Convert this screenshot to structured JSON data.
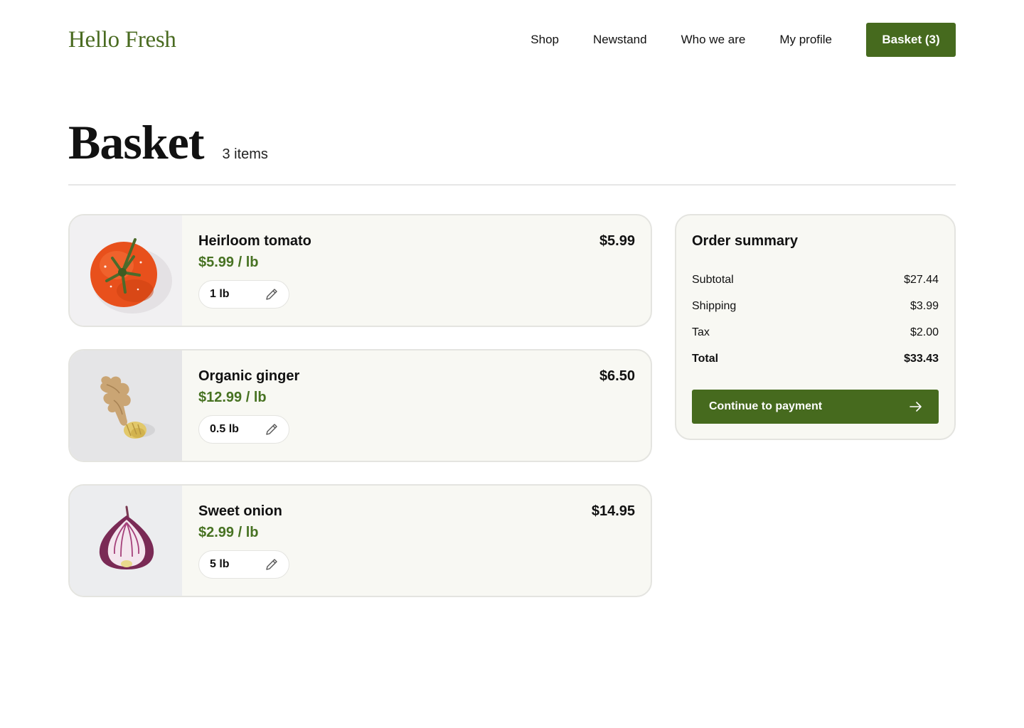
{
  "header": {
    "logo": "Hello Fresh",
    "nav": [
      "Shop",
      "Newstand",
      "Who we are",
      "My profile"
    ],
    "basket_button": "Basket (3)"
  },
  "page": {
    "title": "Basket",
    "item_count": "3 items"
  },
  "items": [
    {
      "name": "Heirloom tomato",
      "unit_price": "$5.99 / lb",
      "total": "$5.99",
      "quantity": "1 lb",
      "image": "tomato-image"
    },
    {
      "name": "Organic ginger",
      "unit_price": "$12.99 / lb",
      "total": "$6.50",
      "quantity": "0.5 lb",
      "image": "ginger-image"
    },
    {
      "name": "Sweet onion",
      "unit_price": "$2.99 / lb",
      "total": "$14.95",
      "quantity": "5 lb",
      "image": "onion-image"
    }
  ],
  "summary": {
    "title": "Order summary",
    "rows": [
      {
        "label": "Subtotal",
        "value": "$27.44"
      },
      {
        "label": "Shipping",
        "value": "$3.99"
      },
      {
        "label": "Tax",
        "value": "$2.00"
      },
      {
        "label": "Total",
        "value": "$33.43"
      }
    ],
    "pay_button": "Continue to payment"
  },
  "colors": {
    "brand_green": "#466a1e",
    "price_green": "#477222",
    "card_bg": "#f8f8f3",
    "border": "#e4e4e0"
  },
  "icons": {
    "edit": "pencil-icon",
    "pay": "arrow-right-icon"
  }
}
